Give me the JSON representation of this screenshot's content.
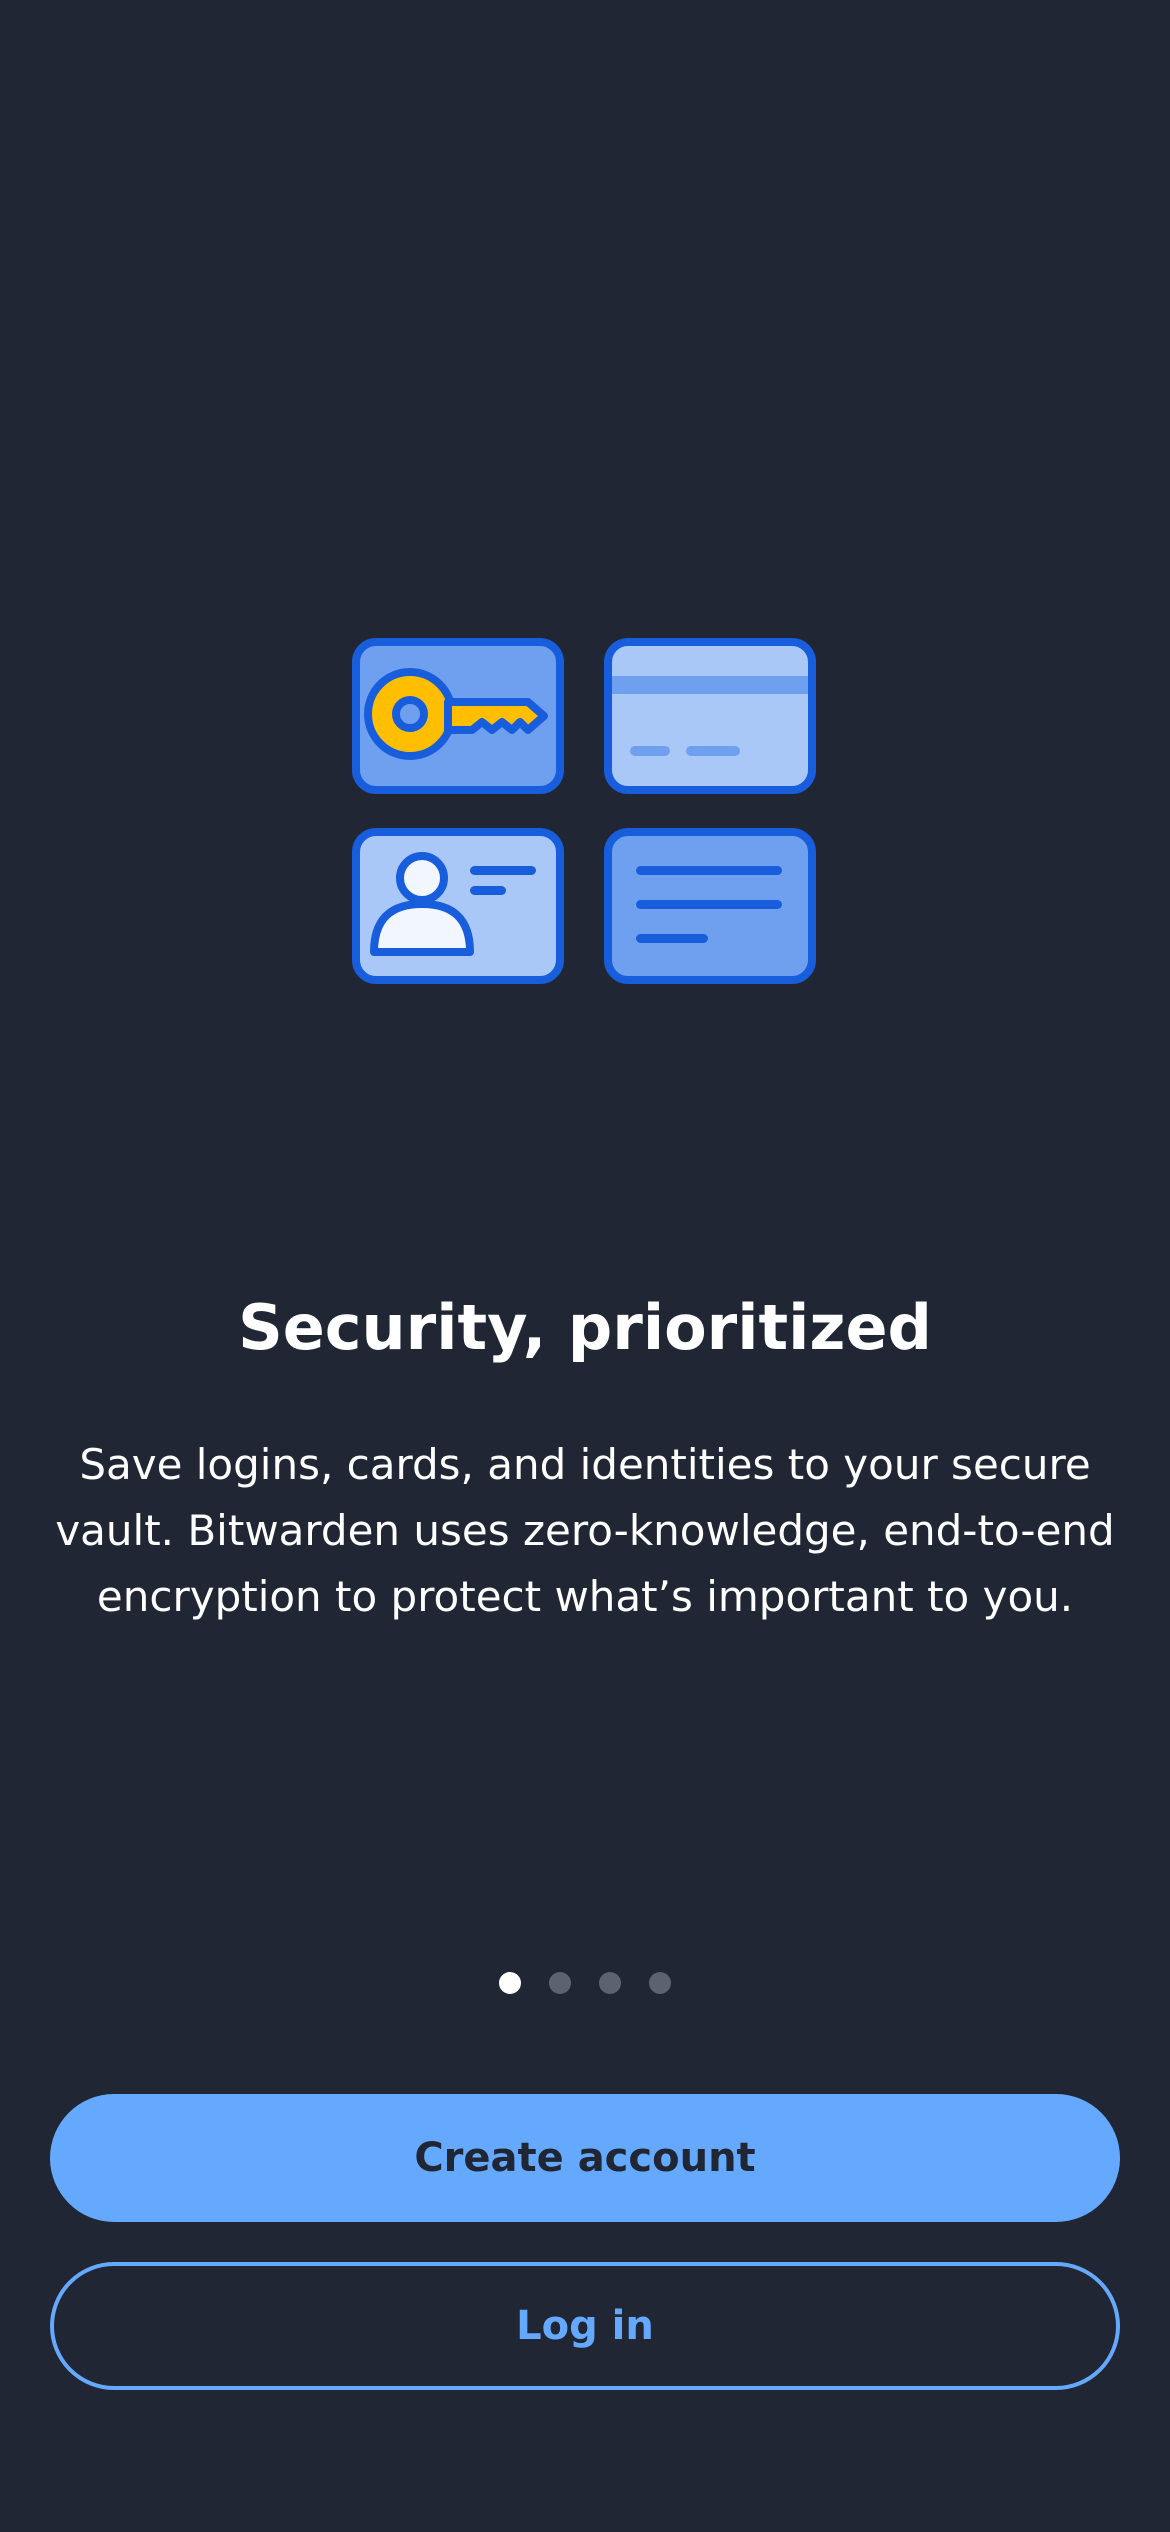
{
  "onboarding": {
    "title": "Security, prioritized",
    "description": "Save logins, cards, and identities to your secure vault. Bitwarden uses zero-knowledge, end-to-end encryption to protect what’s important to you.",
    "pager": {
      "total": 4,
      "active_index": 0
    },
    "illustration_icons": [
      "key-icon",
      "card-icon",
      "identity-icon",
      "note-icon"
    ]
  },
  "actions": {
    "create_account_label": "Create account",
    "login_label": "Log in"
  },
  "colors": {
    "background": "#202633",
    "accent": "#65a9ff",
    "illustration_blue": "#175ddc",
    "key_yellow": "#ffbf00"
  }
}
